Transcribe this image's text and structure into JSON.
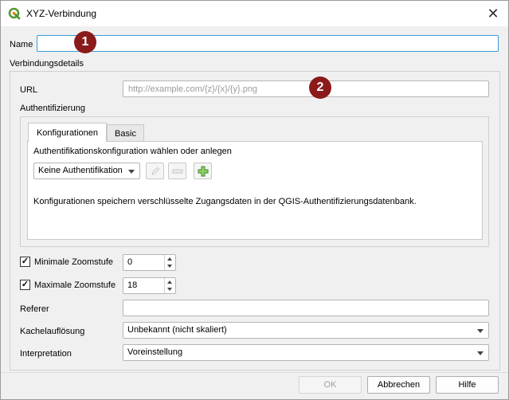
{
  "window": {
    "title": "XYZ-Verbindung"
  },
  "name_field": {
    "label": "Name",
    "value": "",
    "marker": "1"
  },
  "connection_details": {
    "label": "Verbindungsdetails"
  },
  "url_field": {
    "label": "URL",
    "placeholder": "http://example.com/{z}/{x}/{y}.png",
    "marker": "2"
  },
  "auth": {
    "label": "Authentifizierung",
    "tabs": [
      "Konfigurationen",
      "Basic"
    ],
    "active_tab": "Konfigurationen",
    "choose_label": "Authentifikationskonfiguration wählen oder anlegen",
    "selected_config": "Keine Authentifikation",
    "info_text": "Konfigurationen speichern verschlüsselte Zugangsdaten in der QGIS-Authentifizierungsdatenbank."
  },
  "min_zoom": {
    "label": "Minimale Zoomstufe",
    "checked": true,
    "value": "0"
  },
  "max_zoom": {
    "label": "Maximale Zoomstufe",
    "checked": true,
    "value": "18"
  },
  "referer": {
    "label": "Referer",
    "value": ""
  },
  "tile_resolution": {
    "label": "Kachelauflösung",
    "value": "Unbekannt (nicht skaliert)"
  },
  "interpretation": {
    "label": "Interpretation",
    "value": "Voreinstellung"
  },
  "buttons": {
    "ok": "OK",
    "cancel": "Abbrechen",
    "help": "Hilfe"
  },
  "check_mark": "✓",
  "colors": {
    "qgis_green": "#589632",
    "qgis_yellow": "#ee7913",
    "marker": "#8b1a1a",
    "focus": "#3a9ad9"
  }
}
